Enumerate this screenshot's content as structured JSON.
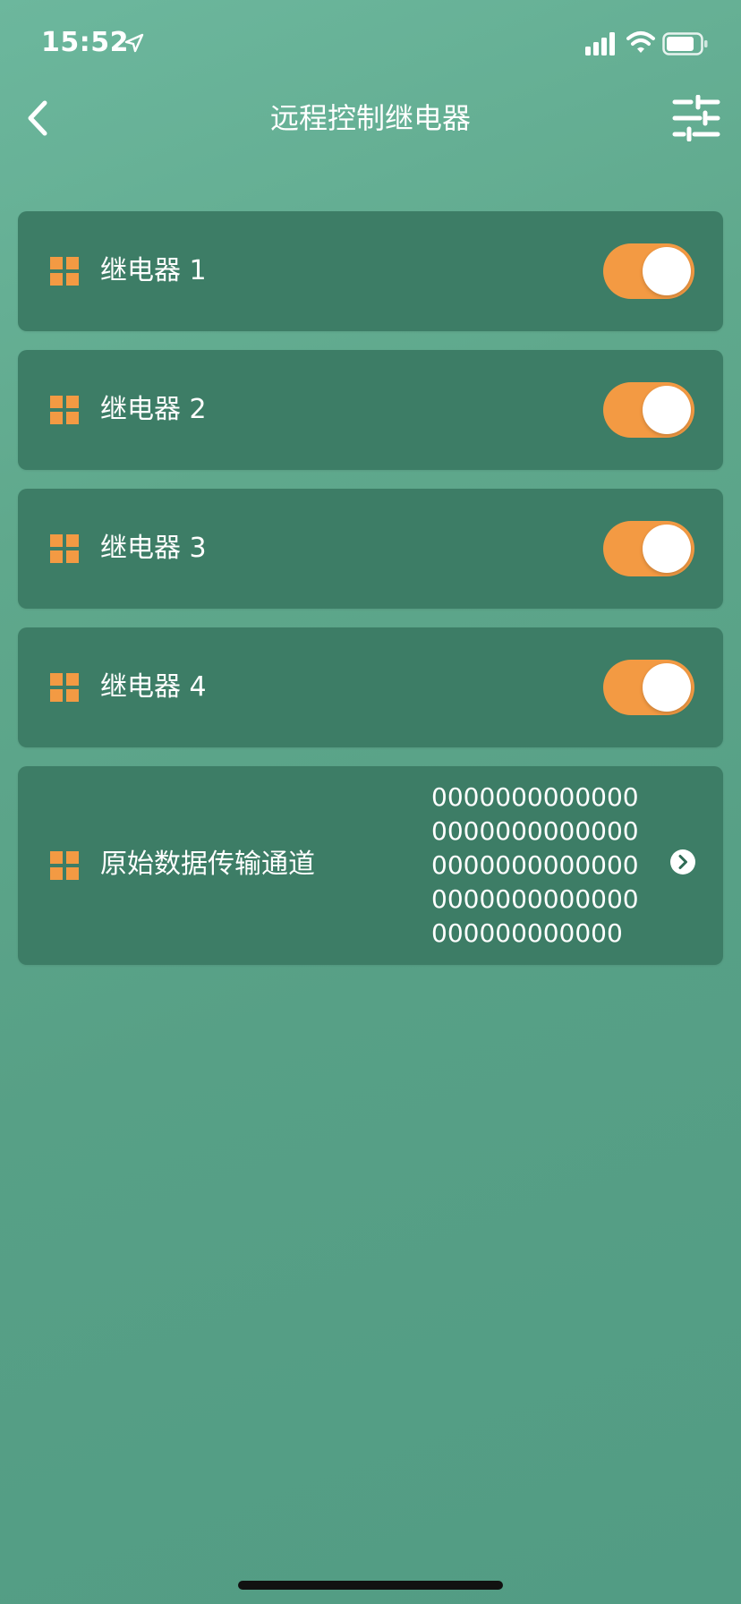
{
  "status_bar": {
    "time": "15:52"
  },
  "nav": {
    "title": "远程控制继电器"
  },
  "relays": [
    {
      "label": "继电器 1",
      "on": true
    },
    {
      "label": "继电器 2",
      "on": true
    },
    {
      "label": "继电器 3",
      "on": true
    },
    {
      "label": "继电器 4",
      "on": true
    }
  ],
  "raw_channel": {
    "label": "原始数据传输通道",
    "values": [
      "0000000000000",
      "0000000000000",
      "0000000000000",
      "0000000000000",
      "000000000000"
    ]
  },
  "colors": {
    "accent": "#f39a43",
    "card": "#3d7d66",
    "background": "#5fa88c"
  },
  "icons": {
    "back": "chevron-left-icon",
    "settings": "sliders-icon",
    "item": "grid-icon",
    "detail": "chevron-right-circle-icon"
  }
}
